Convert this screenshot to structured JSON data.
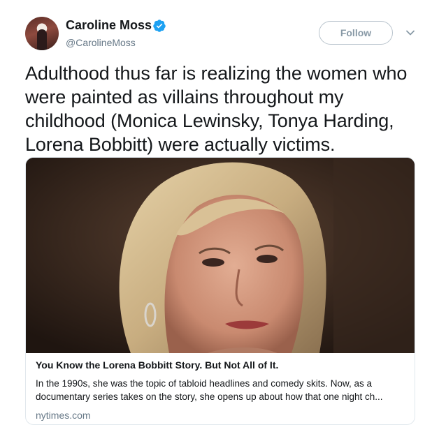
{
  "author": {
    "display_name": "Caroline Moss",
    "handle": "@CarolineMoss",
    "avatar_icon": "profile-photo",
    "verified_icon": "verified-badge-icon",
    "verified_color": "#1da1f2"
  },
  "actions": {
    "follow_label": "Follow",
    "menu_icon": "chevron-down-icon"
  },
  "tweet": {
    "text": "Adulthood thus far is realizing the women who were painted as villains throughout my childhood (Monica Lewinsky, Tonya Harding, Lorena Bobbitt) were actually victims."
  },
  "card": {
    "image_icon": "article-photo",
    "title": "You Know the Lorena Bobbitt Story. But Not All of It.",
    "description": "In the 1990s, she was the topic of tabloid headlines and comedy skits. Now, as a documentary series takes on the story, she opens up about how that one night ch...",
    "domain": "nytimes.com"
  }
}
